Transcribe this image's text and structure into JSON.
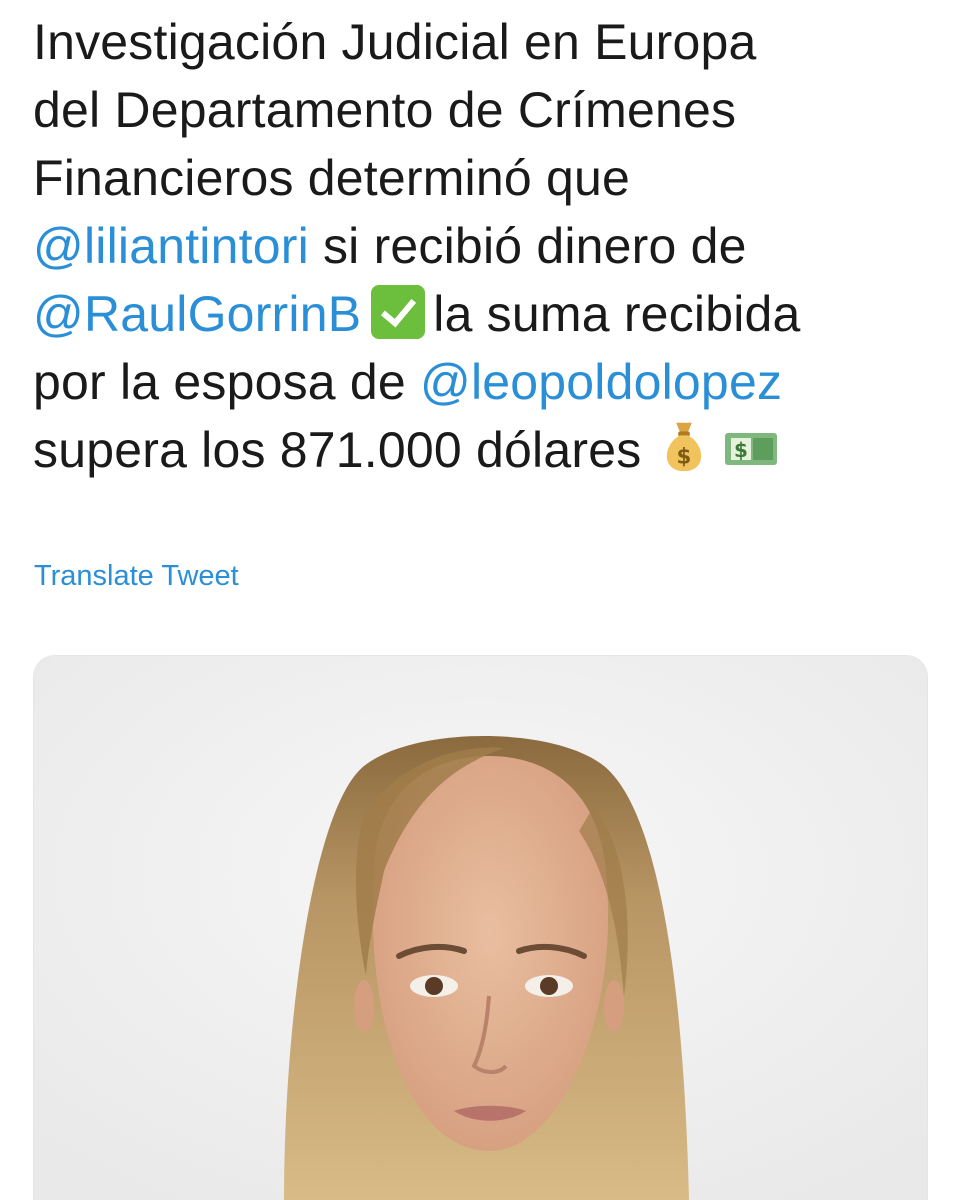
{
  "tweet": {
    "lines": [
      {
        "text": "Investigación Judicial en Europa"
      },
      {
        "text": "del Departamento de Crímenes"
      },
      {
        "text": "Financieros determinó que"
      },
      {
        "mention": "@liliantintori",
        "after": " si recibió dinero de"
      },
      {
        "mention": "@RaulGorrinB",
        "after": "la suma recibida"
      },
      {
        "before": "por la esposa de ",
        "mention": "@leopoldolopez"
      },
      {
        "text": "supera los 871.000 dólares"
      }
    ],
    "emoji": {
      "check": "white-check-mark-icon",
      "money_bag": "money-bag-icon",
      "dollar_bill": "dollar-banknote-icon"
    },
    "translate_label": "Translate Tweet"
  },
  "colors": {
    "mention": "#2a8fd6",
    "text": "#1a1a1a",
    "background": "#ffffff"
  }
}
